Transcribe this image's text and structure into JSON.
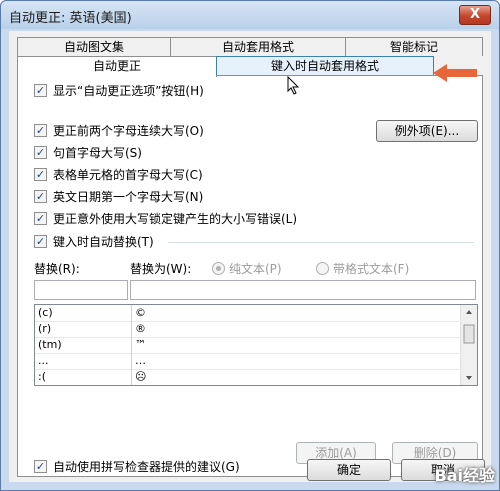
{
  "window": {
    "title": "自动更正: 英语(美国)",
    "close_glyph": "X"
  },
  "tabs_back": [
    {
      "label": "自动图文集"
    },
    {
      "label": "自动套用格式"
    },
    {
      "label": "智能标记"
    }
  ],
  "tabs_front": [
    {
      "label": "自动更正"
    },
    {
      "label": "键入时自动套用格式"
    }
  ],
  "options": {
    "show_buttons": "显示“自动更正选项”按钮(H)",
    "two_initials": "更正前两个字母连续大写(O)",
    "sentence_cap": "句首字母大写(S)",
    "table_cap": "表格单元格的首字母大写(C)",
    "day_cap": "英文日期第一个字母大写(N)",
    "capslock": "更正意外使用大写锁定键产生的大小写错误(L)",
    "replace_typing": "键入时自动替换(T)",
    "spell_suggest": "自动使用拼写检查器提供的建议(G)"
  },
  "checks": {
    "mark": "✓"
  },
  "exceptions_button": "例外项(E)...",
  "replace": {
    "label": "替换(R):",
    "with_label": "替换为(W):",
    "plain_text": "纯文本(P)",
    "formatted_text": "带格式文本(F)",
    "replace_value": "",
    "with_value": ""
  },
  "entries": [
    {
      "from": "(c)",
      "to": "©"
    },
    {
      "from": "(r)",
      "to": "®"
    },
    {
      "from": "(tm)",
      "to": "™"
    },
    {
      "from": "...",
      "to": "…"
    },
    {
      "from": ":(",
      "to": "☹"
    }
  ],
  "buttons": {
    "add": "添加(A)",
    "delete": "删除(D)",
    "ok": "确定",
    "cancel": "取消"
  },
  "watermark": "Bai经验",
  "colors": {
    "arrow": "#e8673a",
    "accent": "#3c7fb1"
  }
}
